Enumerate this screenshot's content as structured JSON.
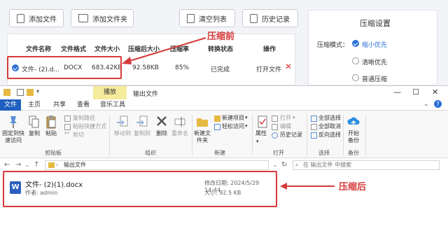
{
  "toolbar": {
    "add_file": "添加文件",
    "add_folder": "添加文件夹",
    "clear_list": "清空列表",
    "history": "历史记录"
  },
  "table": {
    "headers": [
      "文件名称",
      "文件格式",
      "文件大小",
      "压缩后大小",
      "压缩率",
      "转换状态",
      "操作"
    ],
    "row": {
      "name": "文件- (2).d...",
      "format": "DOCX",
      "size": "683.42KB",
      "compressed_size": "92.58KB",
      "ratio": "85%",
      "status": "已完成",
      "open_file": "打开文件",
      "delete": "✕"
    }
  },
  "settings": {
    "title": "压缩设置",
    "mode_label": "压缩模式：",
    "options": [
      {
        "label": "缩小优先",
        "selected": true
      },
      {
        "label": "清晰优先",
        "selected": false
      },
      {
        "label": "普通压缩",
        "selected": false
      }
    ]
  },
  "annotations": {
    "before": "压缩前",
    "after": "压缩后",
    "color": "#d63a3a"
  },
  "explorer": {
    "context_tab": "播放",
    "window_title": "输出文件",
    "tabs": [
      "文件",
      "主页",
      "共享",
      "查看",
      "音乐工具"
    ],
    "ribbon": {
      "pin_quick": "固定到快速访问",
      "copy": "复制",
      "paste": "粘贴",
      "copy_path": "复制路径",
      "paste_shortcut": "粘贴快捷方式",
      "cut": "剪切",
      "clipboard": "剪贴板",
      "move_to": "移动到",
      "copy_to": "复制到",
      "delete": "删除",
      "rename": "重命名",
      "organize": "组织",
      "new_folder": "新建文件夹",
      "new_item": "新建项目",
      "easy_access": "轻松访问",
      "new": "新建",
      "properties": "属性",
      "open": "打开",
      "edit": "编辑",
      "history": "历史记录",
      "open_group": "打开",
      "select_all": "全部选择",
      "select_none": "全部取消",
      "invert": "反向选择",
      "select": "选择",
      "start_backup": "开始备份",
      "backup": "备份"
    },
    "address": "输出文件",
    "search_placeholder": "在 输出文件 中搜索",
    "file": {
      "name": "文件- (2)(1).docx",
      "author": "作者: admin",
      "modified": "修改日期: 2024/5/29 14:44",
      "size": "大小: 92.5 KB"
    }
  },
  "colors": {
    "accent": "#2b6fd6",
    "word_blue": "#2b5fbf",
    "file_tab": "#1f5fbf",
    "context_tab": "#f5eb9c"
  }
}
